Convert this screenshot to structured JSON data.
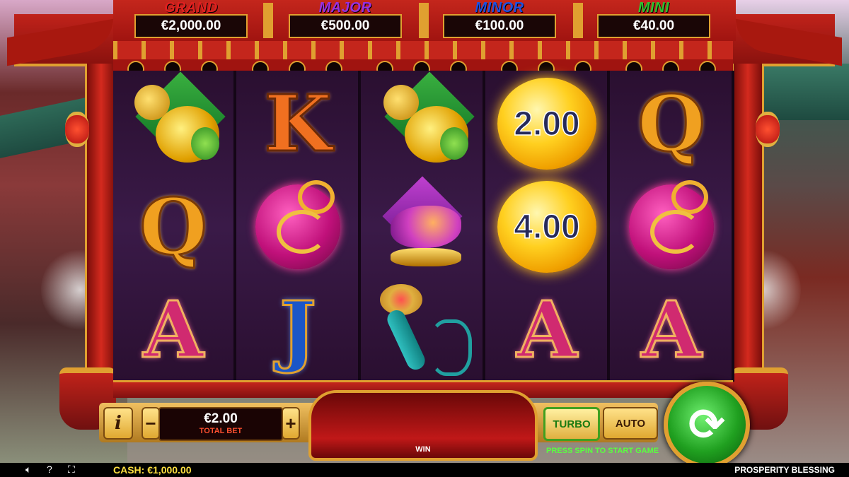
{
  "jackpots": [
    {
      "name": "GRAND",
      "value": "€2,000.00",
      "color": "#e02020"
    },
    {
      "name": "MAJOR",
      "value": "€500.00",
      "color": "#9a30e0"
    },
    {
      "name": "MINOR",
      "value": "€100.00",
      "color": "#2050e0"
    },
    {
      "name": "MINI",
      "value": "€40.00",
      "color": "#30c030"
    }
  ],
  "reels": [
    [
      {
        "symbol": "monkey"
      },
      {
        "symbol": "Q",
        "style": "gold"
      },
      {
        "symbol": "A",
        "style": "pink"
      }
    ],
    [
      {
        "symbol": "K",
        "style": "orange"
      },
      {
        "symbol": "vase"
      },
      {
        "symbol": "J",
        "style": "blue"
      }
    ],
    [
      {
        "symbol": "monkey"
      },
      {
        "symbol": "koi"
      },
      {
        "symbol": "ruyi"
      }
    ],
    [
      {
        "symbol": "coin",
        "value": "2.00"
      },
      {
        "symbol": "coin",
        "value": "4.00"
      },
      {
        "symbol": "A",
        "style": "pink"
      }
    ],
    [
      {
        "symbol": "Q",
        "style": "gold"
      },
      {
        "symbol": "vase"
      },
      {
        "symbol": "A",
        "style": "pink"
      }
    ]
  ],
  "controls": {
    "info_label": "i",
    "minus_label": "−",
    "plus_label": "+",
    "bet_value": "€2.00",
    "bet_label": "TOTAL BET",
    "win_label": "WIN",
    "turbo_label": "TURBO",
    "auto_label": "AUTO",
    "status_message": "PRESS SPIN TO START GAME",
    "spin_icon": "refresh-arrows-icon"
  },
  "footer": {
    "sound_icon": "🔈︎",
    "help_icon": "?",
    "fullscreen_icon": "⛶",
    "cash_label": "CASH:",
    "cash_value": "€1,000.00",
    "game_title": "PROSPERITY BLESSING"
  }
}
